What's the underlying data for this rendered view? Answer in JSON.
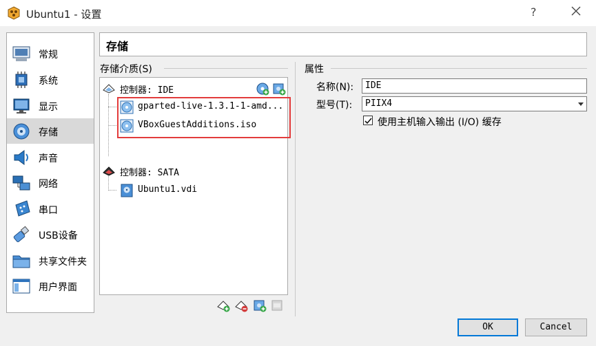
{
  "window": {
    "title": "Ubuntu1 - 设置",
    "help_glyph": "?",
    "icons": [
      "virtualbox-icon",
      "help-icon",
      "close-icon"
    ]
  },
  "sidebar": {
    "items": [
      {
        "label": "常规",
        "icon": "general-icon"
      },
      {
        "label": "系统",
        "icon": "system-chip-icon"
      },
      {
        "label": "显示",
        "icon": "display-monitor-icon"
      },
      {
        "label": "存储",
        "icon": "storage-disk-icon",
        "active": true
      },
      {
        "label": "声音",
        "icon": "speaker-icon"
      },
      {
        "label": "网络",
        "icon": "network-icon"
      },
      {
        "label": "串口",
        "icon": "serial-port-icon"
      },
      {
        "label": "USB设备",
        "icon": "usb-icon"
      },
      {
        "label": "共享文件夹",
        "icon": "shared-folder-icon"
      },
      {
        "label": "用户界面",
        "icon": "user-interface-icon"
      }
    ]
  },
  "page": {
    "title": "存储"
  },
  "storage": {
    "group_title": "存储介质(S)",
    "tree": [
      {
        "label": "控制器: IDE",
        "kind": "controller"
      },
      {
        "label": "gparted-live-1.3.1-1-amd...",
        "kind": "optical",
        "highlighted": true
      },
      {
        "label": "VBoxGuestAdditions.iso",
        "kind": "optical",
        "highlighted": true
      },
      {
        "label": "控制器: SATA",
        "kind": "controller"
      },
      {
        "label": "Ubuntu1.vdi",
        "kind": "disk"
      }
    ]
  },
  "properties": {
    "group_title": "属性",
    "name_label": "名称(N):",
    "name_value": "IDE",
    "type_label": "型号(T):",
    "type_value": "PIIX4",
    "cache_label": "使用主机输入输出 (I/O) 缓存",
    "cache_checked": true
  },
  "buttons": {
    "ok": "OK",
    "cancel": "Cancel"
  },
  "colors": {
    "highlight_border": "#e23b3b",
    "active_item": "#d9d9d9",
    "ok_border": "#0078d7"
  }
}
